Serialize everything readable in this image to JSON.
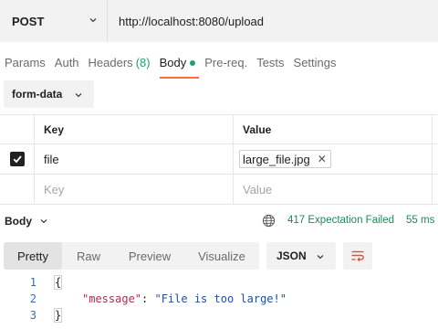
{
  "request": {
    "method": "POST",
    "url": "http://localhost:8080/upload"
  },
  "tabs": [
    {
      "label": "Params"
    },
    {
      "label": "Auth"
    },
    {
      "label": "Headers",
      "count": "(8)"
    },
    {
      "label": "Body"
    },
    {
      "label": "Pre-req."
    },
    {
      "label": "Tests"
    },
    {
      "label": "Settings"
    }
  ],
  "body": {
    "type": "form-data",
    "columns": {
      "key": "Key",
      "value": "Value"
    },
    "rows": [
      {
        "key": "file",
        "value": "large_file.jpg",
        "checked": true
      }
    ],
    "new_row": {
      "key_placeholder": "Key",
      "value_placeholder": "Value"
    }
  },
  "response": {
    "title": "Body",
    "status": "417 Expectation Failed",
    "time": "55 ms",
    "view_tabs": [
      "Pretty",
      "Raw",
      "Preview",
      "Visualize"
    ],
    "active_view": "Pretty",
    "format": "JSON",
    "code": {
      "line_numbers": [
        "1",
        "2",
        "3"
      ],
      "open": "{",
      "key": "\"message\"",
      "sep": ": ",
      "value": "\"File is too large!\"",
      "close": "}"
    }
  },
  "colors": {
    "accent": "#ff6c37",
    "success": "#1aa36f",
    "status": "#1b8b55"
  }
}
